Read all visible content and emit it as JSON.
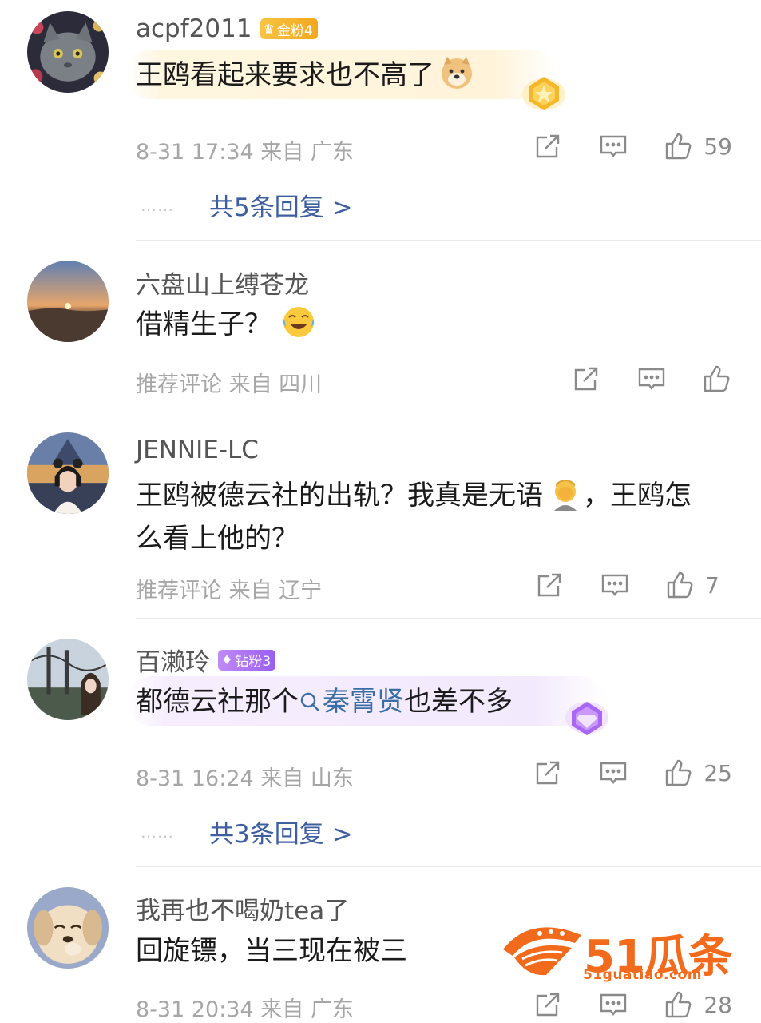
{
  "colors": {
    "link": "#3d5fa0",
    "meta": "#a6a6a6",
    "gold_badge": "#f5b02c",
    "diamond_badge": "#a66bf2",
    "watermark": "#f26b1d"
  },
  "comments": [
    {
      "username": "acpf2011",
      "badge": {
        "label": "金粉4",
        "type": "gold",
        "icon": "crown-icon"
      },
      "text": "王鸥看起来要求也不高了",
      "emoji": "doge-emoji",
      "meta": "8-31 17:34  来自 广东",
      "likes": "59",
      "replies": "共5条回复 >"
    },
    {
      "username": "六盘山上缚苍龙",
      "text": "借精生子？",
      "emoji": "laugh-cry-emoji",
      "meta": "推荐评论  来自 四川",
      "likes": ""
    },
    {
      "username": "JENNIE-LC",
      "text_line1": "王鸥被德云社的出轨？我真是无语",
      "text_line1_end": "，王鸥怎",
      "text_line2": "么看上他的？",
      "emoji": "facepalm-emoji",
      "meta": "推荐评论  来自 辽宁",
      "likes": "7"
    },
    {
      "username": "百濑玲",
      "badge": {
        "label": "钻粉3",
        "type": "diamond",
        "icon": "diamond-icon"
      },
      "text_before": "都德云社那个",
      "topic": "秦霄贤",
      "text_after": "也差不多",
      "meta": "8-31 16:24  来自 山东",
      "likes": "25",
      "replies": "共3条回复 >"
    },
    {
      "username": "我再也不喝奶tea了",
      "text": "回旋镖，当三现在被三",
      "meta": "8-31 20:34  来自 广东",
      "likes": "28"
    }
  ],
  "reply_dots": "……",
  "watermark": {
    "brand": "51瓜条",
    "url": "51guatiao.com"
  }
}
